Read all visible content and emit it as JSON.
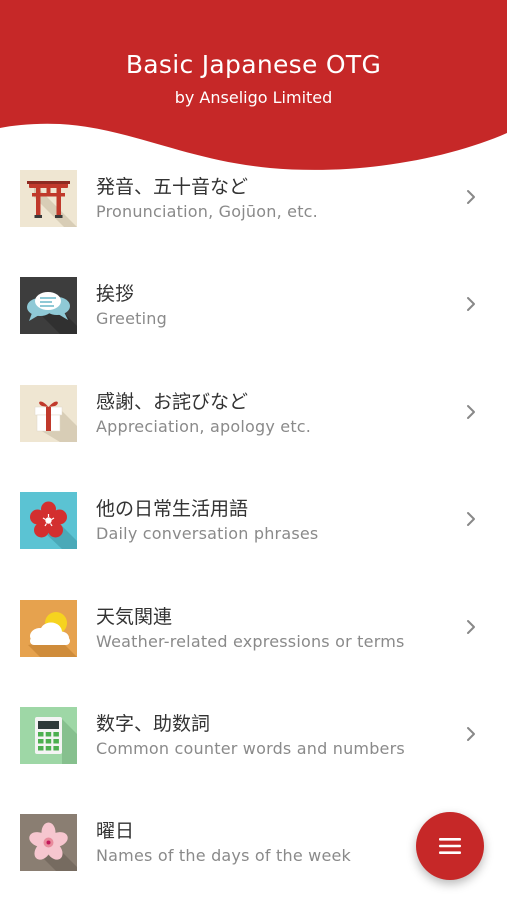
{
  "header": {
    "title": "Basic Japanese OTG",
    "subtitle": "by Anseligo Limited"
  },
  "colors": {
    "brand_red": "#c62828",
    "title_text": "#333333",
    "subtitle_text": "#8a8a8a",
    "chevron": "#888888"
  },
  "menu": {
    "items": [
      {
        "title": "発音、五十音など",
        "subtitle": "Pronunciation, Gojūon, etc.",
        "icon": "torii-gate-icon"
      },
      {
        "title": "挨拶",
        "subtitle": "Greeting",
        "icon": "speech-bubbles-icon"
      },
      {
        "title": "感謝、お詫びなど",
        "subtitle": "Appreciation, apology etc.",
        "icon": "gift-box-icon"
      },
      {
        "title": "他の日常生活用語",
        "subtitle": "Daily conversation phrases",
        "icon": "plum-blossom-icon"
      },
      {
        "title": "天気関連",
        "subtitle": "Weather-related expressions or terms",
        "icon": "sun-cloud-icon"
      },
      {
        "title": "数字、助数詞",
        "subtitle": "Common counter words and numbers",
        "icon": "calculator-icon"
      },
      {
        "title": "曜日",
        "subtitle": "Names of the days of the week",
        "icon": "sakura-flower-icon"
      }
    ]
  },
  "fab": {
    "icon": "hamburger-menu-icon"
  }
}
